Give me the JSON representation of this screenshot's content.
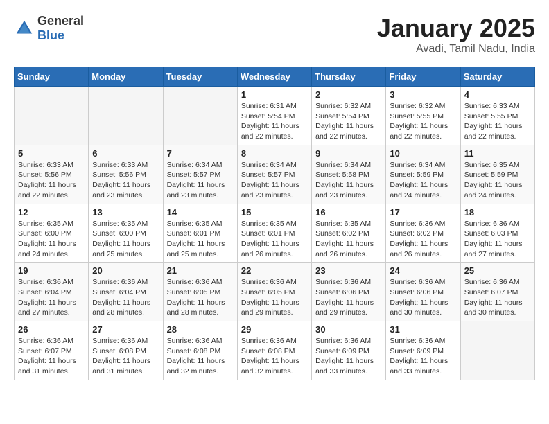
{
  "header": {
    "logo_general": "General",
    "logo_blue": "Blue",
    "title": "January 2025",
    "subtitle": "Avadi, Tamil Nadu, India"
  },
  "weekdays": [
    "Sunday",
    "Monday",
    "Tuesday",
    "Wednesday",
    "Thursday",
    "Friday",
    "Saturday"
  ],
  "weeks": [
    [
      {
        "day": "",
        "info": ""
      },
      {
        "day": "",
        "info": ""
      },
      {
        "day": "",
        "info": ""
      },
      {
        "day": "1",
        "info": "Sunrise: 6:31 AM\nSunset: 5:54 PM\nDaylight: 11 hours and 22 minutes."
      },
      {
        "day": "2",
        "info": "Sunrise: 6:32 AM\nSunset: 5:54 PM\nDaylight: 11 hours and 22 minutes."
      },
      {
        "day": "3",
        "info": "Sunrise: 6:32 AM\nSunset: 5:55 PM\nDaylight: 11 hours and 22 minutes."
      },
      {
        "day": "4",
        "info": "Sunrise: 6:33 AM\nSunset: 5:55 PM\nDaylight: 11 hours and 22 minutes."
      }
    ],
    [
      {
        "day": "5",
        "info": "Sunrise: 6:33 AM\nSunset: 5:56 PM\nDaylight: 11 hours and 22 minutes."
      },
      {
        "day": "6",
        "info": "Sunrise: 6:33 AM\nSunset: 5:56 PM\nDaylight: 11 hours and 23 minutes."
      },
      {
        "day": "7",
        "info": "Sunrise: 6:34 AM\nSunset: 5:57 PM\nDaylight: 11 hours and 23 minutes."
      },
      {
        "day": "8",
        "info": "Sunrise: 6:34 AM\nSunset: 5:57 PM\nDaylight: 11 hours and 23 minutes."
      },
      {
        "day": "9",
        "info": "Sunrise: 6:34 AM\nSunset: 5:58 PM\nDaylight: 11 hours and 23 minutes."
      },
      {
        "day": "10",
        "info": "Sunrise: 6:34 AM\nSunset: 5:59 PM\nDaylight: 11 hours and 24 minutes."
      },
      {
        "day": "11",
        "info": "Sunrise: 6:35 AM\nSunset: 5:59 PM\nDaylight: 11 hours and 24 minutes."
      }
    ],
    [
      {
        "day": "12",
        "info": "Sunrise: 6:35 AM\nSunset: 6:00 PM\nDaylight: 11 hours and 24 minutes."
      },
      {
        "day": "13",
        "info": "Sunrise: 6:35 AM\nSunset: 6:00 PM\nDaylight: 11 hours and 25 minutes."
      },
      {
        "day": "14",
        "info": "Sunrise: 6:35 AM\nSunset: 6:01 PM\nDaylight: 11 hours and 25 minutes."
      },
      {
        "day": "15",
        "info": "Sunrise: 6:35 AM\nSunset: 6:01 PM\nDaylight: 11 hours and 26 minutes."
      },
      {
        "day": "16",
        "info": "Sunrise: 6:35 AM\nSunset: 6:02 PM\nDaylight: 11 hours and 26 minutes."
      },
      {
        "day": "17",
        "info": "Sunrise: 6:36 AM\nSunset: 6:02 PM\nDaylight: 11 hours and 26 minutes."
      },
      {
        "day": "18",
        "info": "Sunrise: 6:36 AM\nSunset: 6:03 PM\nDaylight: 11 hours and 27 minutes."
      }
    ],
    [
      {
        "day": "19",
        "info": "Sunrise: 6:36 AM\nSunset: 6:04 PM\nDaylight: 11 hours and 27 minutes."
      },
      {
        "day": "20",
        "info": "Sunrise: 6:36 AM\nSunset: 6:04 PM\nDaylight: 11 hours and 28 minutes."
      },
      {
        "day": "21",
        "info": "Sunrise: 6:36 AM\nSunset: 6:05 PM\nDaylight: 11 hours and 28 minutes."
      },
      {
        "day": "22",
        "info": "Sunrise: 6:36 AM\nSunset: 6:05 PM\nDaylight: 11 hours and 29 minutes."
      },
      {
        "day": "23",
        "info": "Sunrise: 6:36 AM\nSunset: 6:06 PM\nDaylight: 11 hours and 29 minutes."
      },
      {
        "day": "24",
        "info": "Sunrise: 6:36 AM\nSunset: 6:06 PM\nDaylight: 11 hours and 30 minutes."
      },
      {
        "day": "25",
        "info": "Sunrise: 6:36 AM\nSunset: 6:07 PM\nDaylight: 11 hours and 30 minutes."
      }
    ],
    [
      {
        "day": "26",
        "info": "Sunrise: 6:36 AM\nSunset: 6:07 PM\nDaylight: 11 hours and 31 minutes."
      },
      {
        "day": "27",
        "info": "Sunrise: 6:36 AM\nSunset: 6:08 PM\nDaylight: 11 hours and 31 minutes."
      },
      {
        "day": "28",
        "info": "Sunrise: 6:36 AM\nSunset: 6:08 PM\nDaylight: 11 hours and 32 minutes."
      },
      {
        "day": "29",
        "info": "Sunrise: 6:36 AM\nSunset: 6:08 PM\nDaylight: 11 hours and 32 minutes."
      },
      {
        "day": "30",
        "info": "Sunrise: 6:36 AM\nSunset: 6:09 PM\nDaylight: 11 hours and 33 minutes."
      },
      {
        "day": "31",
        "info": "Sunrise: 6:36 AM\nSunset: 6:09 PM\nDaylight: 11 hours and 33 minutes."
      },
      {
        "day": "",
        "info": ""
      }
    ]
  ]
}
